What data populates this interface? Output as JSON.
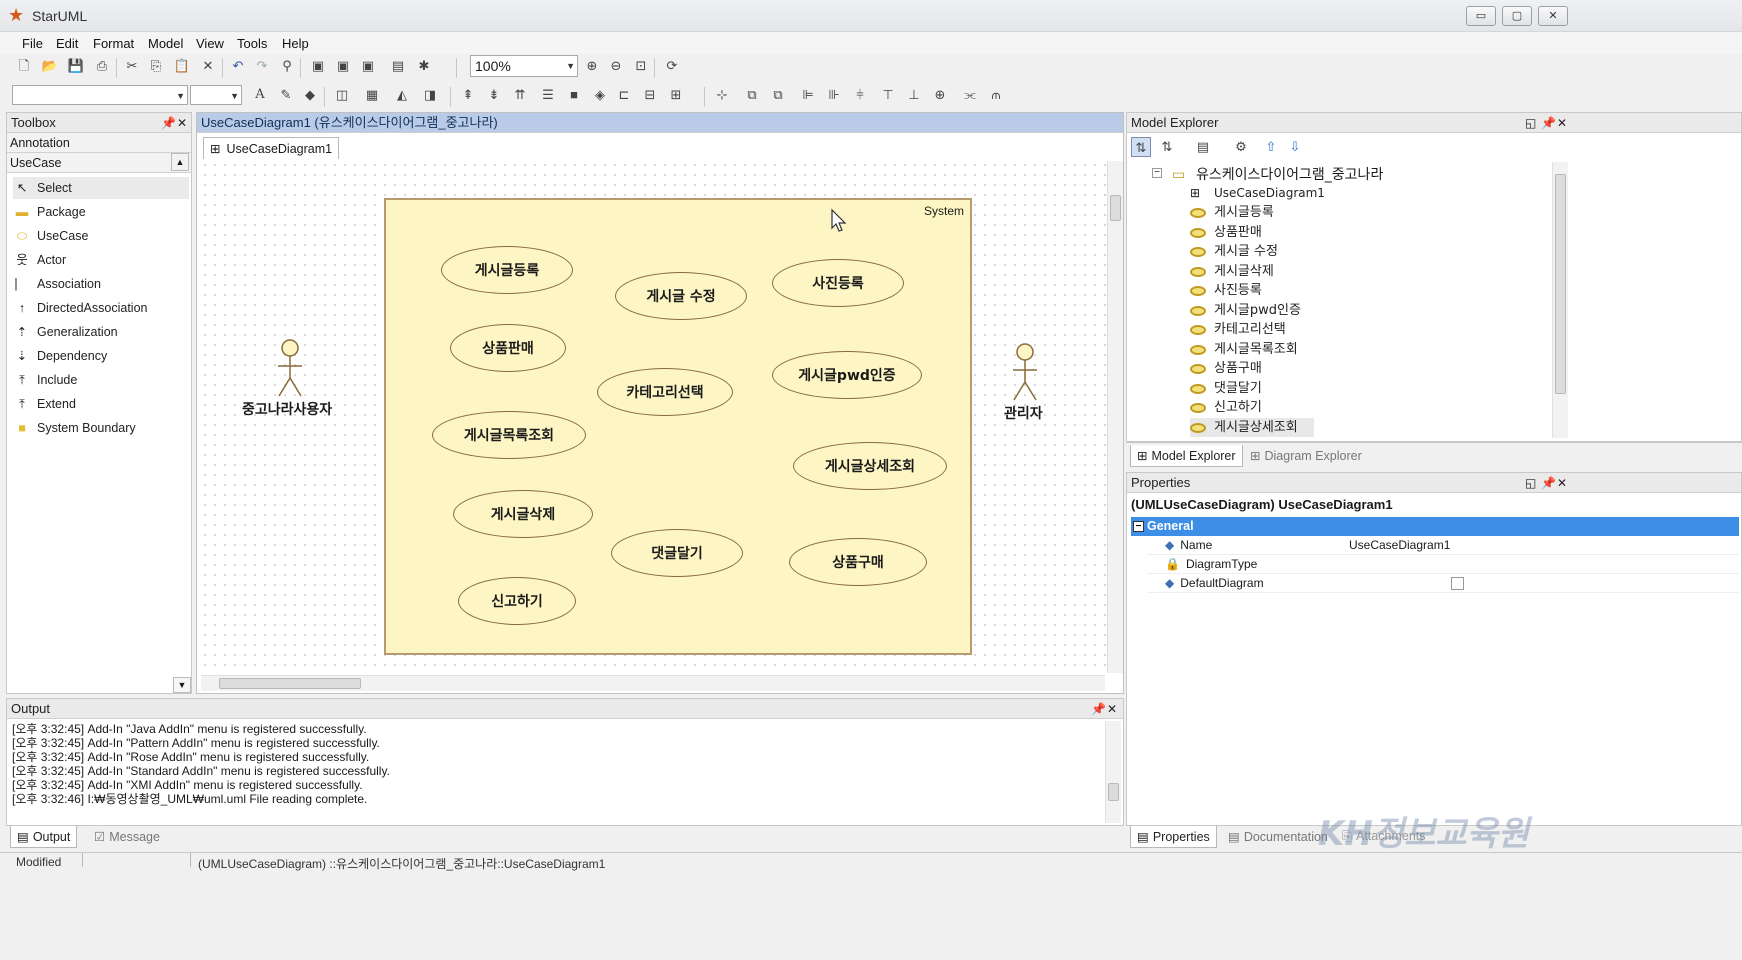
{
  "window": {
    "title": "StarUML",
    "buttons": [
      "▭",
      "▢",
      "✕"
    ]
  },
  "menu": [
    "File",
    "Edit",
    "Format",
    "Model",
    "View",
    "Tools",
    "Help"
  ],
  "toolbar": {
    "zoom": "100%"
  },
  "toolbox": {
    "title": "Toolbox",
    "group_annotation": "Annotation",
    "group_usecase": "UseCase",
    "items": [
      "Select",
      "Package",
      "UseCase",
      "Actor",
      "Association",
      "DirectedAssociation",
      "Generalization",
      "Dependency",
      "Include",
      "Extend",
      "System Boundary"
    ]
  },
  "document": {
    "title": "UseCaseDiagram1 (유스케이스다이어그램_중고나라)",
    "tab": "UseCaseDiagram1"
  },
  "diagram": {
    "boundary_label": "System",
    "actors": [
      "중고나라사용자",
      "관리자"
    ],
    "usecases": [
      "게시글등록",
      "게시글 수정",
      "사진등록",
      "상품판매",
      "카테고리선택",
      "게시글pwd인증",
      "게시글목록조회",
      "게시글상세조회",
      "게시글삭제",
      "댓글달기",
      "상품구매",
      "신고하기"
    ]
  },
  "model_explorer": {
    "title": "Model Explorer",
    "root": "유스케이스다이어그램_중고나라",
    "diagram_item": "UseCaseDiagram1",
    "items": [
      "게시글등록",
      "상품판매",
      "게시글 수정",
      "게시글삭제",
      "사진등록",
      "게시글pwd인증",
      "카테고리선택",
      "게시글목록조회",
      "상품구매",
      "댓글달기",
      "신고하기",
      "게시글상세조회"
    ],
    "tabs": [
      "Model Explorer",
      "Diagram Explorer"
    ]
  },
  "properties": {
    "title": "Properties",
    "header": "(UMLUseCaseDiagram) UseCaseDiagram1",
    "group": "General",
    "rows": [
      {
        "name": "Name",
        "value": "UseCaseDiagram1"
      },
      {
        "name": "DiagramType",
        "value": ""
      },
      {
        "name": "DefaultDiagram",
        "value": ""
      }
    ],
    "tabs": [
      "Properties",
      "Documentation",
      "Attachments"
    ]
  },
  "output": {
    "title": "Output",
    "lines": [
      "[오후 3:32:45]  Add-In \"Java AddIn\" menu is registered successfully.",
      "[오후 3:32:45]  Add-In \"Pattern AddIn\" menu is registered successfully.",
      "[오후 3:32:45]  Add-In \"Rose AddIn\" menu is registered successfully.",
      "[오후 3:32:45]  Add-In \"Standard AddIn\" menu is registered successfully.",
      "[오후 3:32:45]  Add-In \"XMI AddIn\" menu is registered successfully.",
      "[오후 3:32:46]  I:₩동영상촬영_UML₩uml.uml File reading complete."
    ],
    "tabs": [
      "Output",
      "Message"
    ]
  },
  "status": {
    "state": "Modified",
    "path": "(UMLUseCaseDiagram) ::유스케이스다이어그램_중고나라::UseCaseDiagram1"
  },
  "watermark": "KH정보교육원",
  "colors": {
    "boundary_fill": "#fdf6c4",
    "selection": "#3d8ee6",
    "active_title": "#b9cbe6"
  }
}
